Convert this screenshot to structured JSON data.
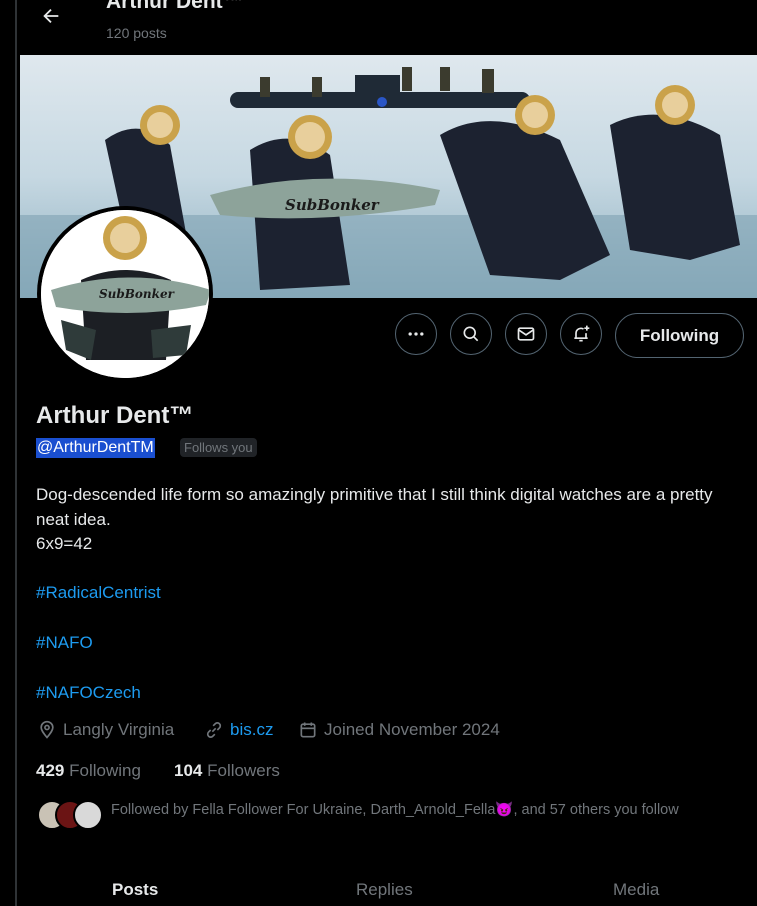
{
  "header": {
    "title": "Arthur Dent™",
    "posts_count": "120 posts"
  },
  "banner": {
    "shark_text": "SubBonker"
  },
  "profile": {
    "display_name": "Arthur Dent™",
    "handle": "@ArthurDentTM",
    "follows_you": "Follows you",
    "avatar_shark_text": "SubBonker"
  },
  "actions": {
    "following_label": "Following"
  },
  "bio": {
    "line1": "Dog-descended life form so amazingly primitive that I still think digital watches are a pretty neat idea.",
    "line2": "6x9=42",
    "hashtags": [
      "#RadicalCentrist",
      "#NAFO",
      "#NAFOCzech"
    ]
  },
  "meta": {
    "location": "Langly Virginia",
    "website": "bis.cz",
    "joined": "Joined November 2024"
  },
  "stats": {
    "following_count": "429",
    "following_label": "Following",
    "followers_count": "104",
    "followers_label": "Followers"
  },
  "followed_by": {
    "text_before": "Followed by Fella Follower For Ukraine, Darth_Arnold_Fella",
    "emoji": "😈",
    "text_after": ", and 57 others you follow"
  },
  "tabs": [
    "Posts",
    "Replies",
    "Media"
  ],
  "colors": {
    "accent": "#1d9bf0",
    "handle_highlight": "#1a4fd0",
    "muted": "#71767b"
  }
}
